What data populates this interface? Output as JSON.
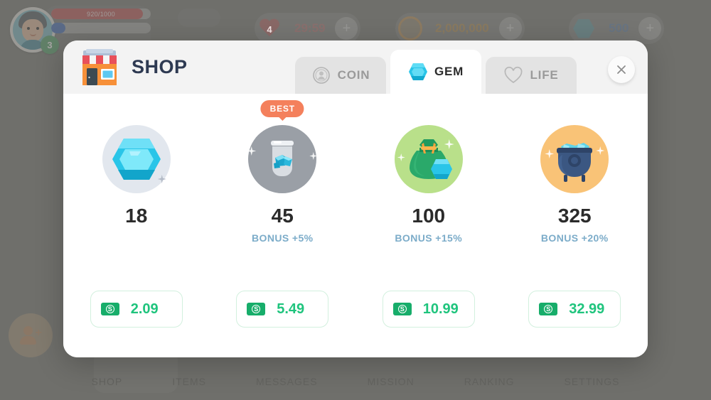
{
  "hud": {
    "avatar": {
      "level": "3",
      "name": "avatar"
    },
    "health_bar": {
      "value": "920/1000"
    },
    "life": {
      "count": "4",
      "timer": "29:59",
      "plus": "+"
    },
    "coin": {
      "value": "2,000,000",
      "plus": "+"
    },
    "gem": {
      "value": "500",
      "plus": "+"
    }
  },
  "bottom_nav": {
    "items": [
      {
        "label": "SHOP",
        "active": true
      },
      {
        "label": "ITEMS",
        "active": false
      },
      {
        "label": "MESSAGES",
        "active": false
      },
      {
        "label": "MISSION",
        "active": false
      },
      {
        "label": "RANKING",
        "active": false
      },
      {
        "label": "SETTINGS",
        "active": false
      }
    ]
  },
  "modal": {
    "title": "SHOP",
    "close_label": "×",
    "tabs": [
      {
        "label": "COIN",
        "icon": "coin-icon",
        "active": false
      },
      {
        "label": "GEM",
        "icon": "gem-icon",
        "active": true
      },
      {
        "label": "LIFE",
        "icon": "heart-icon",
        "active": false
      }
    ],
    "products": [
      {
        "amount": "18",
        "bonus": "",
        "price": "2.09",
        "badge": "",
        "icon": "single-gem-icon",
        "circle_color": "#e2e7ee"
      },
      {
        "amount": "45",
        "bonus": "BONUS +5%",
        "price": "5.49",
        "badge": "BEST",
        "icon": "gem-jar-icon",
        "circle_color": "#9a9fa6"
      },
      {
        "amount": "100",
        "bonus": "BONUS +15%",
        "price": "10.99",
        "badge": "",
        "icon": "gem-bag-icon",
        "circle_color": "#b9e08a"
      },
      {
        "amount": "325",
        "bonus": "BONUS +20%",
        "price": "32.99",
        "badge": "",
        "icon": "gem-cauldron-icon",
        "circle_color": "#f9c377"
      }
    ],
    "currency_icon": "dollar-bill-icon",
    "currency_symbol": "S"
  },
  "colors": {
    "accent_gem": "#29c5e8",
    "price_green": "#1fc47d",
    "bonus_blue": "#7cacc9",
    "badge_orange": "#f4805c",
    "title_navy": "#2e3a52"
  }
}
